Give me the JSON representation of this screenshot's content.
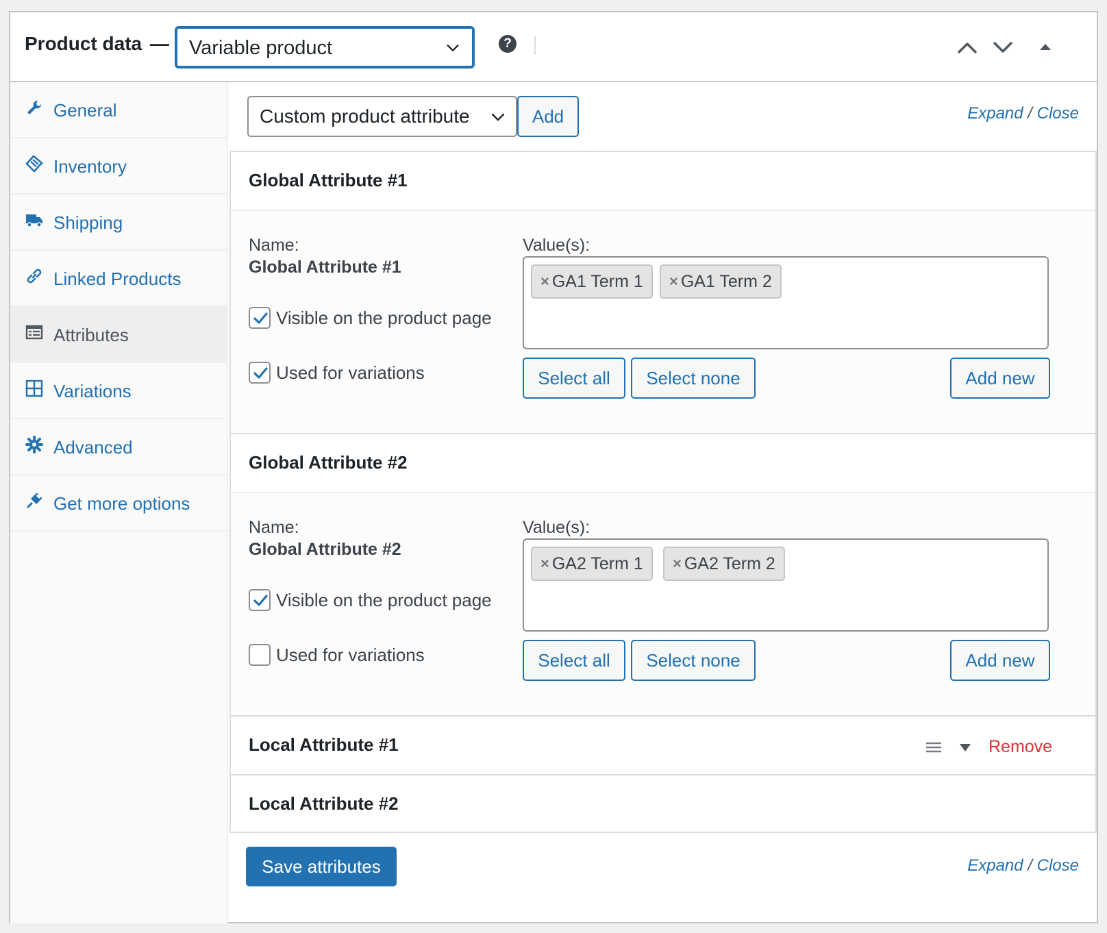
{
  "header": {
    "title": "Product data",
    "dash": "—",
    "product_type": "Variable product",
    "help": "?"
  },
  "sidebar": {
    "items": [
      {
        "label": "General",
        "icon": "wrench-icon"
      },
      {
        "label": "Inventory",
        "icon": "tag-icon"
      },
      {
        "label": "Shipping",
        "icon": "truck-icon"
      },
      {
        "label": "Linked Products",
        "icon": "link-icon"
      },
      {
        "label": "Attributes",
        "icon": "list-table-icon",
        "active": true
      },
      {
        "label": "Variations",
        "icon": "grid-icon"
      },
      {
        "label": "Advanced",
        "icon": "gear-icon"
      },
      {
        "label": "Get more options",
        "icon": "plugin-icon"
      }
    ]
  },
  "toolbar": {
    "attribute_select": "Custom product attribute",
    "add_label": "Add",
    "expand": "Expand",
    "slash": "/",
    "close": "Close"
  },
  "attributes": [
    {
      "title": "Global Attribute #1",
      "name_label": "Name:",
      "name_value": "Global Attribute #1",
      "values_label": "Value(s):",
      "values": [
        "GA1 Term 1",
        "GA1 Term 2"
      ],
      "visible_label": "Visible on the product page",
      "visible_checked": true,
      "variations_label": "Used for variations",
      "variations_checked": true,
      "select_all": "Select all",
      "select_none": "Select none",
      "add_new": "Add new"
    },
    {
      "title": "Global Attribute #2",
      "name_label": "Name:",
      "name_value": "Global Attribute #2",
      "values_label": "Value(s):",
      "values": [
        "GA2 Term 1",
        "GA2 Term 2"
      ],
      "visible_label": "Visible on the product page",
      "visible_checked": true,
      "variations_label": "Used for variations",
      "variations_checked": false,
      "select_all": "Select all",
      "select_none": "Select none",
      "add_new": "Add new"
    }
  ],
  "local_attributes": [
    {
      "title": "Local Attribute #1",
      "remove": "Remove"
    },
    {
      "title": "Local Attribute #2"
    }
  ],
  "footer": {
    "save_label": "Save attributes",
    "expand": "Expand",
    "slash": "/",
    "close": "Close"
  },
  "colors": {
    "accent": "#2271b1",
    "danger": "#d63638",
    "text": "#1d2327"
  },
  "x_glyph": "×"
}
